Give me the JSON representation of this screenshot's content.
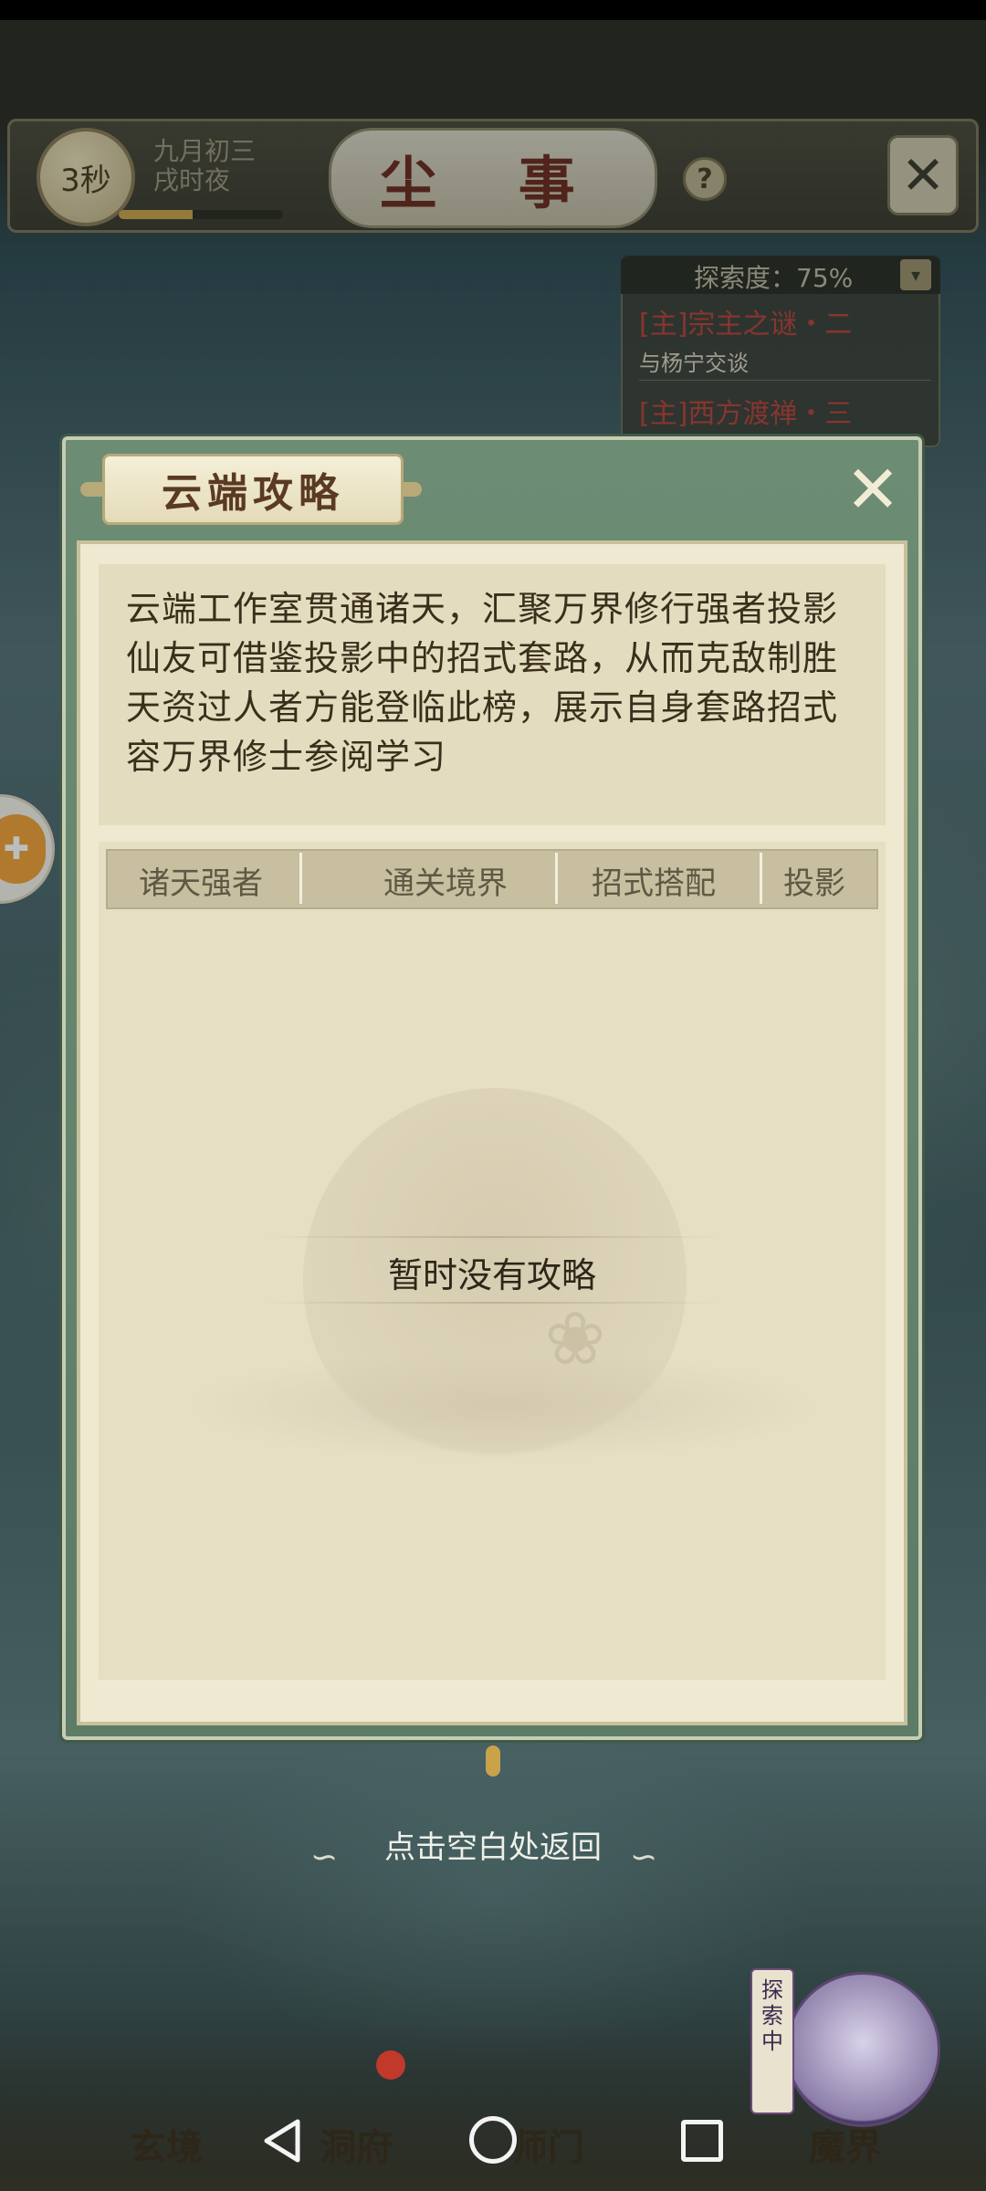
{
  "game_header": {
    "timer": "3秒",
    "date_line1": "九月初三",
    "date_line2": "戌时夜",
    "time_progress": 0.45,
    "scene_title": "尘 事",
    "help_label": "?"
  },
  "quest_panel": {
    "progress_text": "探索度：75%",
    "quests": [
      {
        "title": "[主]宗主之谜・二",
        "subtitle": "与杨宁交谈"
      },
      {
        "title": "[主]西方渡禅・三"
      }
    ]
  },
  "dialog": {
    "title": "云端攻略",
    "description_lines": [
      "云端工作室贯通诸天，汇聚万界修行强者投影",
      "仙友可借鉴投影中的招式套路，从而克敌制胜",
      "天资过人者方能登临此榜，展示自身套路招式",
      "容万界修士参阅学习"
    ],
    "columns": [
      "诸天强者",
      "通关境界",
      "招式搭配",
      "投影"
    ],
    "empty_text": "暂时没有攻略"
  },
  "hint": "点击空白处返回",
  "bottom_nav": {
    "items": [
      "玄境",
      "洞府",
      "师门",
      "魔界"
    ],
    "explore_badge": "探索中"
  },
  "colors": {
    "dialog_frame": "#6d8c74",
    "dialog_paper": "#efe9d1",
    "title_text": "#5a3a22",
    "quest_title": "#b8423a"
  }
}
